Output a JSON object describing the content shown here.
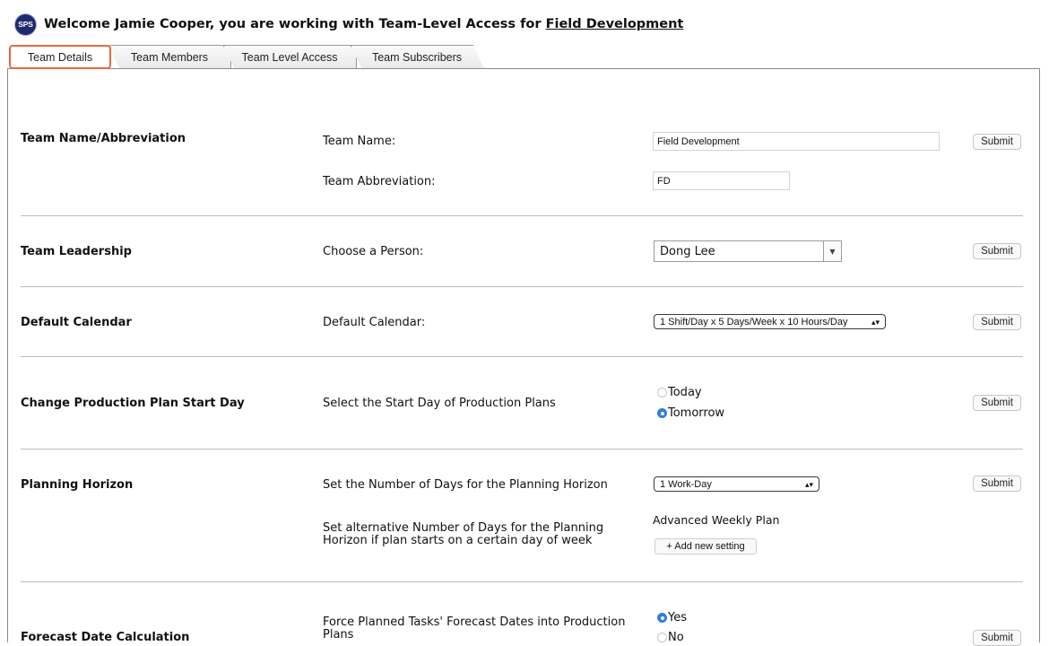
{
  "header": {
    "logo_text": "SPS",
    "welcome_prefix": "Welcome Jamie Cooper, you are working with Team-Level Access for ",
    "team_link": "Field Development"
  },
  "tabs": [
    {
      "label": "Team Details",
      "active": true
    },
    {
      "label": "Team Members",
      "active": false
    },
    {
      "label": "Team Level Access",
      "active": false
    },
    {
      "label": "Team Subscribers",
      "active": false
    }
  ],
  "submit_label": "Submit",
  "sections": {
    "team_name": {
      "title": "Team Name/Abbreviation",
      "name_label": "Team Name:",
      "name_value": "Field Development",
      "abbr_label": "Team Abbreviation:",
      "abbr_value": "FD"
    },
    "leadership": {
      "title": "Team Leadership",
      "label": "Choose a Person:",
      "value": "Dong Lee"
    },
    "calendar": {
      "title": "Default Calendar",
      "label": "Default Calendar:",
      "value": "1 Shift/Day x 5 Days/Week x 10 Hours/Day"
    },
    "start_day": {
      "title": "Change Production Plan Start Day",
      "label": "Select the Start Day of Production Plans",
      "options": [
        "Today",
        "Tomorrow"
      ],
      "selected": "Tomorrow"
    },
    "horizon": {
      "title": "Planning Horizon",
      "label": "Set the Number of Days for the Planning Horizon",
      "value": "1 Work-Day",
      "alt_label_line1": "Set alternative Number of Days for the Planning",
      "alt_label_line2": "Horizon if plan starts on a certain day of week",
      "advanced_label": "Advanced Weekly Plan",
      "add_button": "+ Add new setting"
    },
    "forecast": {
      "title": "Forecast Date Calculation",
      "label_line1": "Force Planned Tasks' Forecast Dates into Production",
      "label_line2": "Plans",
      "options": [
        "Yes",
        "No"
      ],
      "selected": "Yes"
    }
  }
}
